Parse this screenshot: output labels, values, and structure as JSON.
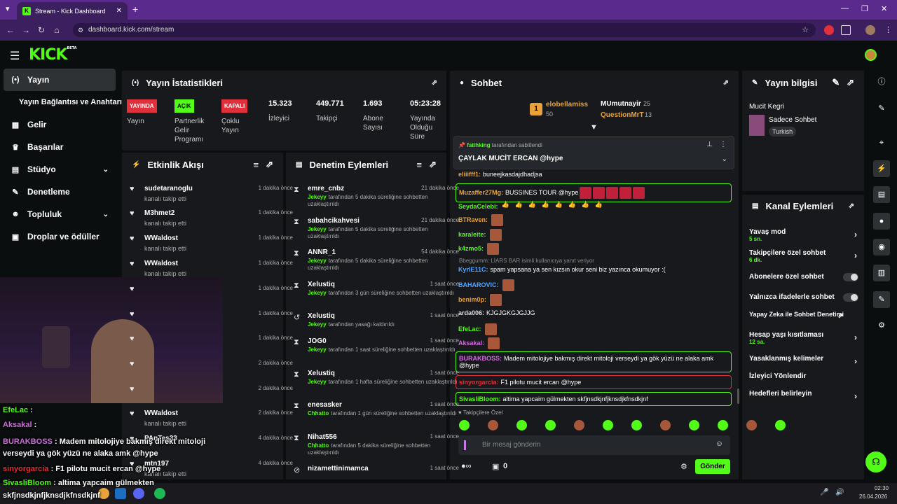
{
  "browser": {
    "tab_title": "Stream - Kick Dashboard",
    "url": "dashboard.kick.com/stream"
  },
  "sidebar": {
    "items": [
      {
        "label": "Yayın",
        "icon": "broadcast-icon"
      },
      {
        "label": "Yayın Bağlantısı ve Anahtarı"
      },
      {
        "label": "Gelir",
        "icon": "revenue-icon"
      },
      {
        "label": "Başarılar",
        "icon": "trophy-icon"
      },
      {
        "label": "Stüdyo",
        "icon": "studio-icon"
      },
      {
        "label": "Denetleme",
        "icon": "wrench-icon"
      },
      {
        "label": "Topluluk",
        "icon": "community-icon"
      },
      {
        "label": "Droplar ve ödüller",
        "icon": "gift-icon"
      }
    ]
  },
  "stats": {
    "title": "Yayın İstatistikleri",
    "live_badge": "YAYINDA",
    "live_label": "Yayın",
    "partner_badge": "AÇIK",
    "partner_label": "Partnerlik Gelir Programı",
    "multi_badge": "KAPALI",
    "multi_label": "Çoklu Yayın",
    "viewers": "15.323",
    "viewers_label": "İzleyici",
    "followers": "449.771",
    "followers_label": "Takipçi",
    "subs": "1.693",
    "subs_label": "Abone Sayısı",
    "uptime": "05:23:28",
    "uptime_label": "Yayında Olduğu Süre"
  },
  "activity": {
    "title": "Etkinlik Akışı",
    "items": [
      {
        "name": "sudetaranoglu",
        "sub": "kanalı takip etti",
        "time": "1 dakika önce"
      },
      {
        "name": "M3hmet2",
        "sub": "kanalı takip etti",
        "time": "1 dakika önce"
      },
      {
        "name": "WWaldost",
        "sub": "kanalı takip etti",
        "time": "1 dakika önce"
      },
      {
        "name": "WWaldost",
        "sub": "kanalı takip etti",
        "time": "1 dakika önce"
      },
      {
        "time": "1 dakika önce"
      },
      {
        "time": "1 dakika önce"
      },
      {
        "time": "1 dakika önce"
      },
      {
        "time": "2 dakika önce"
      },
      {
        "time": "2 dakika önce"
      },
      {
        "name": "WWaldost",
        "sub": "kanalı takip etti",
        "time": "2 dakika önce"
      },
      {
        "name": "PAnTes33",
        "time": "4 dakika önce"
      },
      {
        "name": "mtn197",
        "sub": "kanalı takip etti",
        "time": "4 dakika önce"
      }
    ]
  },
  "modlog": {
    "title": "Denetim Eylemleri",
    "items": [
      {
        "name": "emre_cnbz",
        "by": "Jekeyy",
        "text": "tarafından 5 dakika süreliğine sohbetten uzaklaştırıldı",
        "time": "21 dakika önce"
      },
      {
        "name": "sabahcikahvesi",
        "by": "Jekeyy",
        "text": "tarafından 5 dakika süreliğine sohbetten uzaklaştırıldı",
        "time": "21 dakika önce"
      },
      {
        "name": "ANNR_1",
        "by": "Jekeyy",
        "text": "tarafından 5 dakika süreliğine sohbetten uzaklaştırıldı",
        "time": "54 dakika önce"
      },
      {
        "name": "Xelustiq",
        "by": "Jekeyy",
        "text": "tarafından 3 gün süreliğine sohbetten uzaklaştırıldı",
        "time": "1 saat önce"
      },
      {
        "name": "Xelustiq",
        "by": "Jekeyy",
        "text": "tarafından yasağı kaldırıldı",
        "time": "1 saat önce"
      },
      {
        "name": "JOG0",
        "by": "Jekeyy",
        "text": "tarafından 1 saat süreliğine sohbetten uzaklaştırıldı",
        "time": "1 saat önce"
      },
      {
        "name": "Xelustiq",
        "by": "Jekeyy",
        "text": "tarafından 1 hafta süreliğine sohbetten uzaklaştırıldı",
        "time": "1 saat önce"
      },
      {
        "name": "enesasker",
        "by": "Chhatto",
        "text": "tarafından 1 gün süreliğine sohbetten uzaklaştırıldı",
        "time": "1 saat önce"
      },
      {
        "name": "Nihat556",
        "by": "Chhatto",
        "text": "tarafından 5 dakika süreliğine sohbetten uzaklaştırıldı",
        "time": "1 saat önce"
      },
      {
        "name": "nizamettinimamca",
        "time": "1 saat önce"
      }
    ]
  },
  "chat": {
    "title": "Sohbet",
    "top1_name": "elobellamiss",
    "top1_val": "50",
    "top2_name": "MUmutnayir",
    "top2_val": "25",
    "top3_name": "QuestionMrT",
    "top3_val": "13",
    "pin_by": "fatihking",
    "pin_label": "tarafından sabitlendi",
    "pin_text": "ÇAYLAK MUCİT ERCAN @hype",
    "reply_note": "Bbeggumm: LİARS BAR isimli kullanıcıya yanıt veriyor",
    "subs_label": "Takipçilere Özel",
    "input_placeholder": "Bir mesaj gönderin",
    "points": "0",
    "send_label": "Gönder",
    "messages": [
      {
        "user": "eliiifff1:",
        "text": "buneejkasdajdhadjsa",
        "color": "#e9a23b"
      },
      {
        "user": "Muzaffer27Mg:",
        "text": "BUSSINES TOUR @hype",
        "color": "#e9a23b"
      },
      {
        "user": "SeydaCelebi:",
        "text": "",
        "color": "#53fc18"
      },
      {
        "user": "BTRaven:",
        "text": "",
        "color": "#e9a23b"
      },
      {
        "user": "karaleite:",
        "text": "",
        "color": "#53fc18"
      },
      {
        "user": "k4zmo5:",
        "text": "",
        "color": "#53fc18"
      },
      {
        "user": "KyrIE11C:",
        "text": "spam yapsana ya sen kızsın okur seni biz yazınca okumuyor :(",
        "color": "#4ea3ff"
      },
      {
        "user": "BAHAROVIC:",
        "text": "",
        "color": "#4ea3ff"
      },
      {
        "user": "benim0p:",
        "text": "",
        "color": "#e9a23b"
      },
      {
        "user": "arda006:",
        "text": "KJGJGKGJGJJG",
        "color": "#ddd"
      },
      {
        "user": "EfeLac:",
        "text": "",
        "color": "#53fc18"
      },
      {
        "user": "Aksakal:",
        "text": "",
        "color": "#d36be0"
      },
      {
        "user": "BURAKBOSS:",
        "text": "Madem mitolojiye bakmış direkt mitoloji verseydi ya gök yüzü ne alaka amk @hype",
        "color": "#d36be0"
      },
      {
        "user": "sinyorgarcia:",
        "text": "F1 pilotu mucit ercan @hype",
        "color": "#e0303b"
      },
      {
        "user": "SivasliBloom:",
        "text": "altima yapcaim gülmekten skfjnsdkjnfjknsdjkfnsdkjnf",
        "color": "#53fc18"
      }
    ]
  },
  "info": {
    "title": "Yayın bilgisi",
    "stream_title": "Mucit Kegri",
    "category": "Sadece Sohbet",
    "language": "Turkish"
  },
  "channel": {
    "title": "Kanal Eylemleri",
    "items": [
      {
        "label": "Yavaş mod",
        "sub": "5 sn."
      },
      {
        "label": "Takipçilere özel sohbet",
        "sub": "6 dk."
      },
      {
        "label": "Abonelere özel sohbet"
      },
      {
        "label": "Yalnızca ifadelerle sohbet"
      },
      {
        "label": "Yapay Zeka ile Sohbet Denetimi"
      },
      {
        "label": "Hesap yaşı kısıtlaması",
        "sub": "12 sa."
      },
      {
        "label": "Yasaklanmış kelimeler"
      },
      {
        "label": "İzleyici Yönlendir"
      },
      {
        "label": "Hedefleri belirleyin"
      }
    ]
  },
  "overlay": {
    "lines": [
      {
        "user": "EfeLac",
        "text": "",
        "color": "#53fc18"
      },
      {
        "user": "Aksakal",
        "text": "",
        "color": "#d36be0"
      },
      {
        "user": "BURAKBOSS",
        "text": "Madem mitolojiye bakmış direkt mitoloji",
        "color": "#d36be0"
      },
      {
        "user": "",
        "text": "verseydi ya gök yüzü ne alaka amk @hype",
        "color": "#fff"
      },
      {
        "user": "sinyorgarcia",
        "text": "F1 pilotu mucit ercan @hype",
        "color": "#e0303b"
      },
      {
        "user": "SivasliBloom",
        "text": "altima yapcaim gülmekten",
        "color": "#53fc18"
      },
      {
        "user": "",
        "text": "skfjnsdkjnfjknsdjkfnsdkjnf",
        "color": "#fff"
      }
    ]
  },
  "taskbar": {
    "time": "02:30",
    "date": "26.04.2026"
  },
  "colors": {
    "accent": "#53fc18",
    "panel": "#17191c",
    "bg": "#0b0e0f",
    "live": "#e0303b"
  }
}
